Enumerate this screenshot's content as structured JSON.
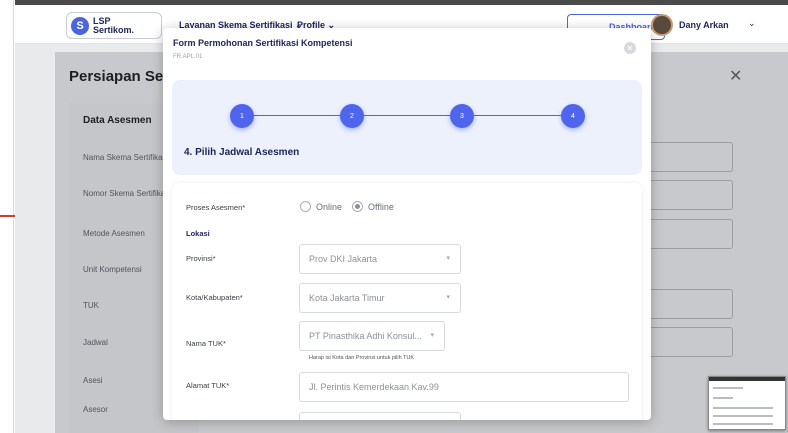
{
  "nav": {
    "logo_line1": "LSP",
    "logo_line2": "Sertikom.",
    "item1": "Layanan Skema Sertifikasi",
    "item2": "Profile",
    "dashboard": "Dashboard",
    "user_name": "Dany Arkan"
  },
  "background": {
    "title": "Persiapan Sebe",
    "section_title": "Data Asesmen",
    "labels": [
      "Nama Skema Sertifikas",
      "Nomor Skema Sertifika",
      "Metode Asesmen",
      "Unit Kompetensi",
      "TUK",
      "Jadwal",
      "Asesi",
      "Asesor"
    ]
  },
  "modal": {
    "title": "Form Permohonan Sertifikasi Kompetensi",
    "subtitle": "FR.APL.01",
    "steps": [
      "1",
      "2",
      "3",
      "4"
    ],
    "step_title": "4. Pilih Jadwal Asesmen",
    "form": {
      "proses_label": "Proses Asesmen*",
      "option_online": "Online",
      "option_offline": "Offline",
      "selected_option": "Offline",
      "lokasi_label": "Lokasi",
      "provinsi_label": "Provinsi*",
      "provinsi_value": "Prov DKI Jakarta",
      "kota_label": "Kota/Kabupaten*",
      "kota_value": "Kota Jakarta Timur",
      "tuk_label": "Nama TUK*",
      "tuk_value": "PT Pinasthika Adhi Konsul...",
      "tuk_hint": "Harap isi Kota dan Provinsi untuk pilih TUK",
      "alamat_label": "Alamat TUK*",
      "alamat_value": "Jl. Perintis Kemerdekaan Kav.99"
    }
  },
  "colors": {
    "primary": "#4f66ec",
    "navy": "#1b2559",
    "overlay": "#c8c9cc",
    "stepper_bg": "#edf1fc"
  }
}
